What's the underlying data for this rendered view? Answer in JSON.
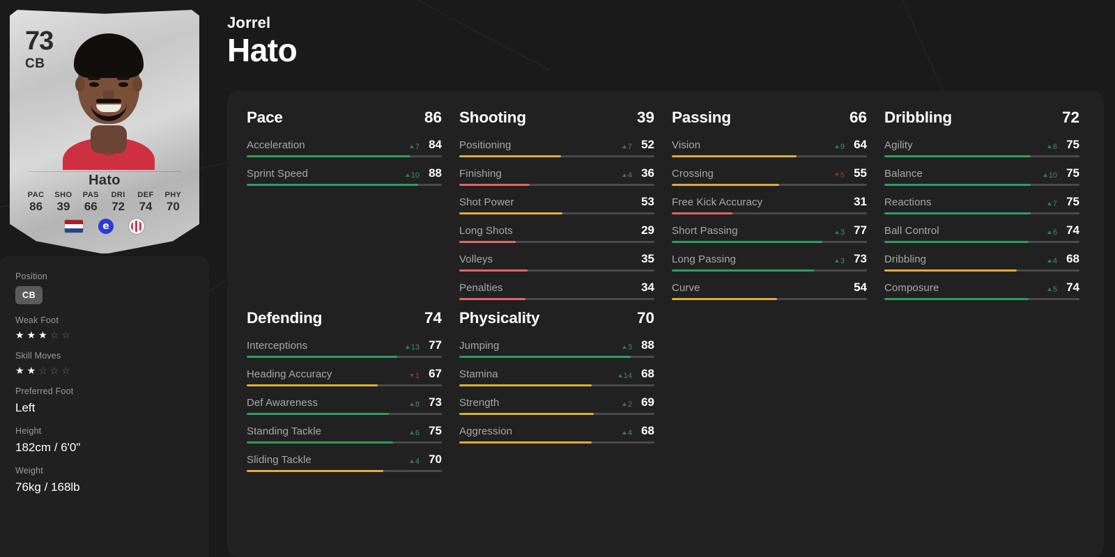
{
  "player": {
    "first_name": "Jorrel",
    "last_name": "Hato",
    "card": {
      "rating": "73",
      "position": "CB",
      "name": "Hato",
      "stats": [
        {
          "label": "PAC",
          "value": "86"
        },
        {
          "label": "SHO",
          "value": "39"
        },
        {
          "label": "PAS",
          "value": "66"
        },
        {
          "label": "DRI",
          "value": "72"
        },
        {
          "label": "DEF",
          "value": "74"
        },
        {
          "label": "PHY",
          "value": "70"
        }
      ],
      "nation_icon": "netherlands-flag-icon",
      "league_icon": "eredivisie-badge-icon",
      "club_icon": "ajax-badge-icon",
      "league_glyph": "e"
    }
  },
  "info": {
    "position": {
      "label": "Position",
      "value": "CB"
    },
    "weak_foot": {
      "label": "Weak Foot",
      "filled": 3,
      "total": 5
    },
    "skill_moves": {
      "label": "Skill Moves",
      "filled": 2,
      "total": 5
    },
    "preferred_foot": {
      "label": "Preferred Foot",
      "value": "Left"
    },
    "height": {
      "label": "Height",
      "value": "182cm / 6'0\""
    },
    "weight": {
      "label": "Weight",
      "value": "76kg / 168lb"
    }
  },
  "colors": {
    "green": "#2f9e5f",
    "yellow": "#e0ac3a",
    "red": "#e06565",
    "track": "#4a4a4a",
    "delta_up": "#2f7d52",
    "delta_down": "#8e2f2f"
  },
  "groups": [
    {
      "title": "Pace",
      "value": "86",
      "stats": [
        {
          "name": "Acceleration",
          "value": "84",
          "delta": "7",
          "dir": "up",
          "bar": 84,
          "color": "green"
        },
        {
          "name": "Sprint Speed",
          "value": "88",
          "delta": "10",
          "dir": "up",
          "bar": 88,
          "color": "green"
        }
      ]
    },
    {
      "title": "Shooting",
      "value": "39",
      "stats": [
        {
          "name": "Positioning",
          "value": "52",
          "delta": "7",
          "dir": "up",
          "bar": 52,
          "color": "yellow"
        },
        {
          "name": "Finishing",
          "value": "36",
          "delta": "4",
          "dir": "up",
          "bar": 36,
          "color": "red"
        },
        {
          "name": "Shot Power",
          "value": "53",
          "delta": "",
          "dir": "",
          "bar": 53,
          "color": "yellow"
        },
        {
          "name": "Long Shots",
          "value": "29",
          "delta": "",
          "dir": "",
          "bar": 29,
          "color": "red"
        },
        {
          "name": "Volleys",
          "value": "35",
          "delta": "",
          "dir": "",
          "bar": 35,
          "color": "red"
        },
        {
          "name": "Penalties",
          "value": "34",
          "delta": "",
          "dir": "",
          "bar": 34,
          "color": "red"
        }
      ]
    },
    {
      "title": "Passing",
      "value": "66",
      "stats": [
        {
          "name": "Vision",
          "value": "64",
          "delta": "9",
          "dir": "up",
          "bar": 64,
          "color": "yellow"
        },
        {
          "name": "Crossing",
          "value": "55",
          "delta": "5",
          "dir": "down",
          "bar": 55,
          "color": "yellow"
        },
        {
          "name": "Free Kick Accuracy",
          "value": "31",
          "delta": "",
          "dir": "",
          "bar": 31,
          "color": "red"
        },
        {
          "name": "Short Passing",
          "value": "77",
          "delta": "3",
          "dir": "up",
          "bar": 77,
          "color": "green"
        },
        {
          "name": "Long Passing",
          "value": "73",
          "delta": "3",
          "dir": "up",
          "bar": 73,
          "color": "green"
        },
        {
          "name": "Curve",
          "value": "54",
          "delta": "",
          "dir": "",
          "bar": 54,
          "color": "yellow"
        }
      ]
    },
    {
      "title": "Dribbling",
      "value": "72",
      "stats": [
        {
          "name": "Agility",
          "value": "75",
          "delta": "6",
          "dir": "up",
          "bar": 75,
          "color": "green"
        },
        {
          "name": "Balance",
          "value": "75",
          "delta": "10",
          "dir": "up",
          "bar": 75,
          "color": "green"
        },
        {
          "name": "Reactions",
          "value": "75",
          "delta": "7",
          "dir": "up",
          "bar": 75,
          "color": "green"
        },
        {
          "name": "Ball Control",
          "value": "74",
          "delta": "6",
          "dir": "up",
          "bar": 74,
          "color": "green"
        },
        {
          "name": "Dribbling",
          "value": "68",
          "delta": "4",
          "dir": "up",
          "bar": 68,
          "color": "yellow"
        },
        {
          "name": "Composure",
          "value": "74",
          "delta": "5",
          "dir": "up",
          "bar": 74,
          "color": "green"
        }
      ]
    },
    {
      "title": "Defending",
      "value": "74",
      "stats": [
        {
          "name": "Interceptions",
          "value": "77",
          "delta": "13",
          "dir": "up",
          "bar": 77,
          "color": "green"
        },
        {
          "name": "Heading Accuracy",
          "value": "67",
          "delta": "1",
          "dir": "down",
          "bar": 67,
          "color": "yellow"
        },
        {
          "name": "Def Awareness",
          "value": "73",
          "delta": "8",
          "dir": "up",
          "bar": 73,
          "color": "green"
        },
        {
          "name": "Standing Tackle",
          "value": "75",
          "delta": "6",
          "dir": "up",
          "bar": 75,
          "color": "green"
        },
        {
          "name": "Sliding Tackle",
          "value": "70",
          "delta": "4",
          "dir": "up",
          "bar": 70,
          "color": "yellow"
        }
      ]
    },
    {
      "title": "Physicality",
      "value": "70",
      "stats": [
        {
          "name": "Jumping",
          "value": "88",
          "delta": "3",
          "dir": "up",
          "bar": 88,
          "color": "green"
        },
        {
          "name": "Stamina",
          "value": "68",
          "delta": "14",
          "dir": "up",
          "bar": 68,
          "color": "yellow"
        },
        {
          "name": "Strength",
          "value": "69",
          "delta": "2",
          "dir": "up",
          "bar": 69,
          "color": "yellow"
        },
        {
          "name": "Aggression",
          "value": "68",
          "delta": "4",
          "dir": "up",
          "bar": 68,
          "color": "yellow"
        }
      ]
    }
  ]
}
